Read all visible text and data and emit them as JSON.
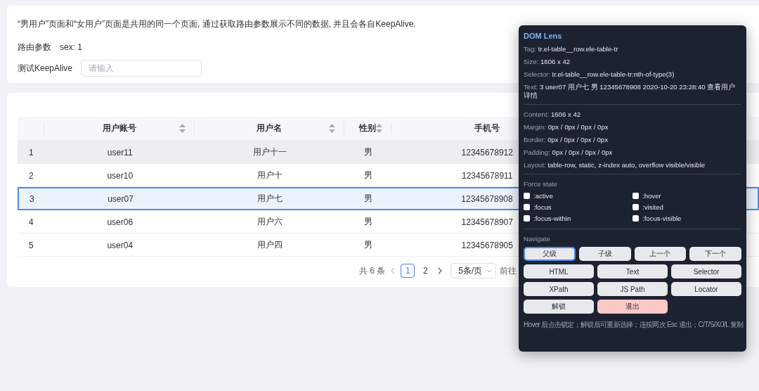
{
  "intro": {
    "description": "“男用户”页面和“女用户”页面是共用的同一个页面, 通过获取路由参数展示不同的数据, 并且会各自KeepAlive.",
    "route_params": {
      "label": "路由参数",
      "value": "sex: 1"
    },
    "keepalive": {
      "label": "测试KeepAlive",
      "placeholder": "请输入"
    }
  },
  "table": {
    "columns": [
      {
        "sortable": false
      },
      {
        "label": "用户账号",
        "sortable": true
      },
      {
        "label": "用户名",
        "sortable": true
      },
      {
        "label": "性别",
        "sortable": true
      },
      {
        "label": "手机号"
      }
    ],
    "rows": [
      {
        "cells": [
          "1",
          "user11",
          "用户十一",
          "男",
          "12345678912"
        ],
        "hovered": true,
        "selected": false
      },
      {
        "cells": [
          "2",
          "user10",
          "用户十",
          "男",
          "12345678911"
        ],
        "hovered": false,
        "selected": false
      },
      {
        "cells": [
          "3",
          "user07",
          "用户七",
          "男",
          "12345678908"
        ],
        "hovered": false,
        "selected": true
      },
      {
        "cells": [
          "4",
          "user06",
          "用户六",
          "男",
          "12345678907"
        ],
        "hovered": false,
        "selected": false
      },
      {
        "cells": [
          "5",
          "user04",
          "用户四",
          "男",
          "12345678905"
        ],
        "hovered": false,
        "selected": false
      }
    ]
  },
  "pagination": {
    "total": "共 6 条",
    "pages": [
      {
        "label": "1",
        "selected": true
      },
      {
        "label": "2",
        "selected": false
      }
    ],
    "page_size": "5条/页",
    "goto": "前往"
  },
  "dom_lens": {
    "title": "DOM Lens",
    "info": [
      {
        "key": "Tag:",
        "value": "tr.el-table__row.ele-table-tr"
      },
      {
        "key": "Size:",
        "value": "1606 x 42"
      },
      {
        "key": "Selector:",
        "value": "tr.el-table__row.ele-table-tr:nth-of-type(3)"
      },
      {
        "key": "Text:",
        "value": "3 user07 用户七 男 12345678908 2020-10-20 23:28:40 查看用户详情"
      }
    ],
    "box": [
      {
        "key": "Content:",
        "value": "1606 x 42"
      },
      {
        "key": "Margin:",
        "value": "0px / 0px / 0px / 0px"
      },
      {
        "key": "Border:",
        "value": "0px / 0px / 0px / 0px"
      },
      {
        "key": "Padding:",
        "value": "0px / 0px / 0px / 0px"
      },
      {
        "key": "Layout:",
        "value": "table-row, static, z-index auto, overflow visible/visible"
      }
    ],
    "force_state": {
      "title": "Force state",
      "options": [
        {
          "label": ":active",
          "checked": false
        },
        {
          "label": ":hover",
          "checked": false
        },
        {
          "label": ":focus",
          "checked": false
        },
        {
          "label": ":visited",
          "checked": false
        },
        {
          "label": ":focus-within",
          "checked": false
        },
        {
          "label": ":focus-visible",
          "checked": false
        }
      ]
    },
    "navigate": {
      "title": "Navigate",
      "nav_buttons": [
        {
          "label": "父级",
          "selected": true
        },
        {
          "label": "子级",
          "selected": false
        },
        {
          "label": "上一个",
          "selected": false
        },
        {
          "label": "下一个",
          "selected": false
        }
      ],
      "copy_buttons": [
        "HTML",
        "Text",
        "Selector",
        "XPath",
        "JS Path",
        "Locator"
      ],
      "actions": [
        {
          "label": "解锁",
          "kind": "normal"
        },
        {
          "label": "退出",
          "kind": "danger"
        }
      ]
    },
    "hint": "Hover 后点击锁定；解锁后可重新选择；连按两次 Esc 退出；C/T/S/X/J/L 复制"
  }
}
